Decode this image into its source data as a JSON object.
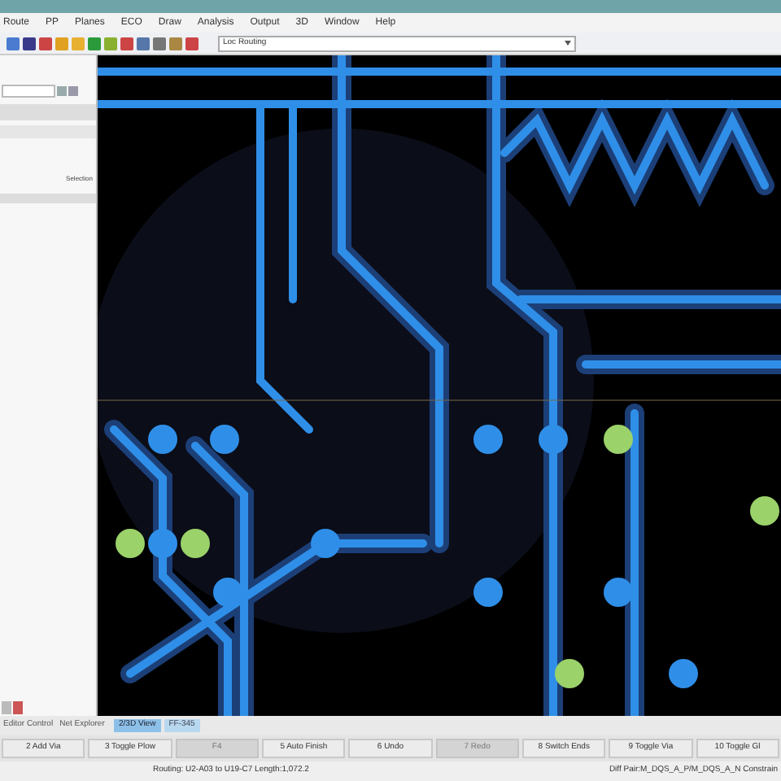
{
  "menu": [
    "Route",
    "PP",
    "Planes",
    "ECO",
    "Draw",
    "Analysis",
    "Output",
    "3D",
    "Window",
    "Help"
  ],
  "toolbar": {
    "dropdown": "Loc Routing"
  },
  "panel": {
    "selection_label": "Selection"
  },
  "bottom_tabs": [
    {
      "label": "Editor Control",
      "selected": false
    },
    {
      "label": "Net Explorer",
      "selected": false
    }
  ],
  "view_tabs": [
    {
      "label": "2/3D View",
      "selected": true
    },
    {
      "label": "FF-345",
      "selected": false
    }
  ],
  "function_keys": [
    {
      "label": "2 Add Via",
      "disabled": false
    },
    {
      "label": "3 Toggle Plow",
      "disabled": false
    },
    {
      "label": "F4",
      "disabled": true
    },
    {
      "label": "5 Auto Finish",
      "disabled": false
    },
    {
      "label": "6 Undo",
      "disabled": false
    },
    {
      "label": "7 Redo",
      "disabled": true
    },
    {
      "label": "8 Switch Ends",
      "disabled": false
    },
    {
      "label": "9 Toggle Via",
      "disabled": false
    },
    {
      "label": "10 Toggle Gl",
      "disabled": false
    }
  ],
  "status_bar": {
    "left": "Routing: U2-A03 to U19-C7 Length:1,072.2",
    "right": "Diff Pair:M_DQS_A_P/M_DQS_A_N Constrain"
  }
}
